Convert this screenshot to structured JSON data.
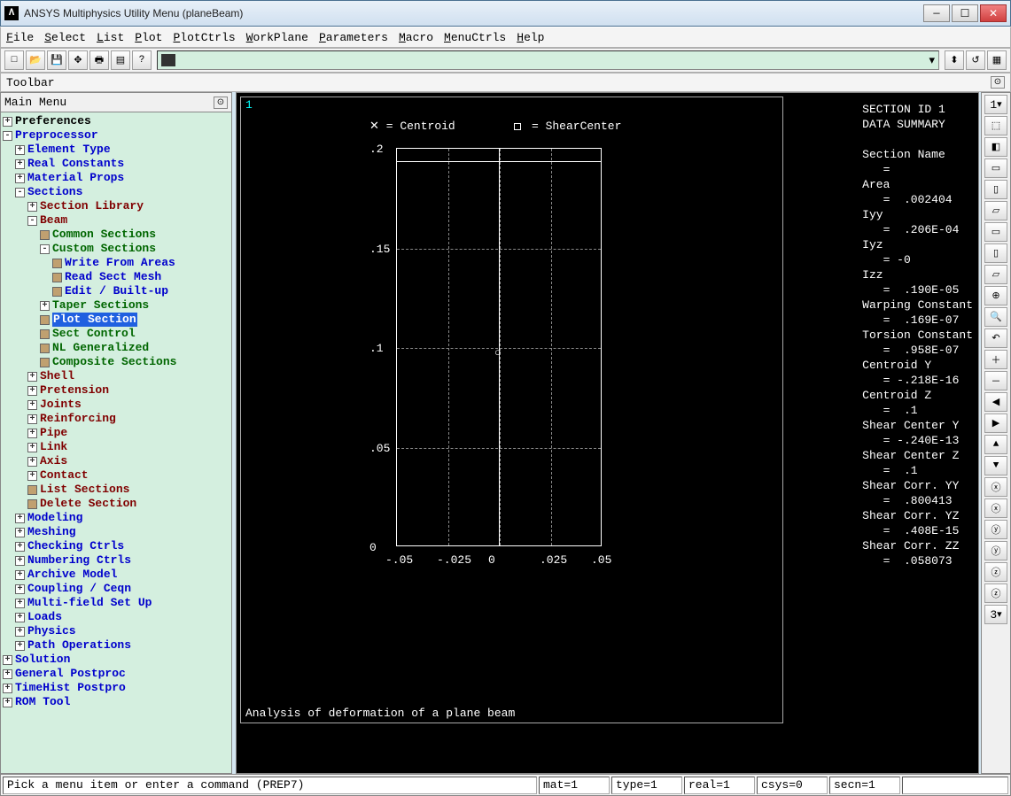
{
  "title": "ANSYS Multiphysics Utility Menu (planeBeam)",
  "menus": [
    "File",
    "Select",
    "List",
    "Plot",
    "PlotCtrls",
    "WorkPlane",
    "Parameters",
    "Macro",
    "MenuCtrls",
    "Help"
  ],
  "toolbar_label": "Toolbar",
  "mainmenu_label": "Main Menu",
  "tree": [
    {
      "ind": 0,
      "box": "⊞",
      "lbl": "Preferences",
      "cls": "black",
      "icon": "mini"
    },
    {
      "ind": 0,
      "box": "⊟",
      "lbl": "Preprocessor",
      "cls": "blue"
    },
    {
      "ind": 1,
      "box": "⊞",
      "lbl": "Element Type",
      "cls": "blue"
    },
    {
      "ind": 1,
      "box": "⊞",
      "lbl": "Real Constants",
      "cls": "blue"
    },
    {
      "ind": 1,
      "box": "⊞",
      "lbl": "Material Props",
      "cls": "blue"
    },
    {
      "ind": 1,
      "box": "⊟",
      "lbl": "Sections",
      "cls": "blue"
    },
    {
      "ind": 2,
      "box": "⊞",
      "lbl": "Section Library",
      "cls": "darkred"
    },
    {
      "ind": 2,
      "box": "⊟",
      "lbl": "Beam",
      "cls": "darkred"
    },
    {
      "ind": 3,
      "box": "",
      "lbl": "Common Sections",
      "cls": "green",
      "icon": "mini"
    },
    {
      "ind": 3,
      "box": "⊟",
      "lbl": "Custom Sections",
      "cls": "green"
    },
    {
      "ind": 4,
      "box": "",
      "lbl": "Write From Areas",
      "cls": "blue",
      "icon": "mini"
    },
    {
      "ind": 4,
      "box": "",
      "lbl": "Read Sect Mesh",
      "cls": "blue",
      "icon": "mini"
    },
    {
      "ind": 4,
      "box": "",
      "lbl": "Edit / Built-up",
      "cls": "blue",
      "icon": "mini"
    },
    {
      "ind": 3,
      "box": "⊞",
      "lbl": "Taper Sections",
      "cls": "green"
    },
    {
      "ind": 3,
      "box": "",
      "lbl": "Plot Section",
      "cls": "green",
      "icon": "mini",
      "sel": true
    },
    {
      "ind": 3,
      "box": "",
      "lbl": "Sect Control",
      "cls": "green",
      "icon": "mini"
    },
    {
      "ind": 3,
      "box": "",
      "lbl": "NL Generalized",
      "cls": "green",
      "icon": "mini"
    },
    {
      "ind": 3,
      "box": "",
      "lbl": "Composite Sections",
      "cls": "green",
      "icon": "mini"
    },
    {
      "ind": 2,
      "box": "⊞",
      "lbl": "Shell",
      "cls": "darkred"
    },
    {
      "ind": 2,
      "box": "⊞",
      "lbl": "Pretension",
      "cls": "darkred"
    },
    {
      "ind": 2,
      "box": "⊞",
      "lbl": "Joints",
      "cls": "darkred"
    },
    {
      "ind": 2,
      "box": "⊞",
      "lbl": "Reinforcing",
      "cls": "darkred"
    },
    {
      "ind": 2,
      "box": "⊞",
      "lbl": "Pipe",
      "cls": "darkred"
    },
    {
      "ind": 2,
      "box": "⊞",
      "lbl": "Link",
      "cls": "darkred"
    },
    {
      "ind": 2,
      "box": "⊞",
      "lbl": "Axis",
      "cls": "darkred"
    },
    {
      "ind": 2,
      "box": "⊞",
      "lbl": "Contact",
      "cls": "darkred"
    },
    {
      "ind": 2,
      "box": "",
      "lbl": "List Sections",
      "cls": "darkred",
      "icon": "mini"
    },
    {
      "ind": 2,
      "box": "",
      "lbl": "Delete Section",
      "cls": "darkred",
      "icon": "mini"
    },
    {
      "ind": 1,
      "box": "⊞",
      "lbl": "Modeling",
      "cls": "blue"
    },
    {
      "ind": 1,
      "box": "⊞",
      "lbl": "Meshing",
      "cls": "blue"
    },
    {
      "ind": 1,
      "box": "⊞",
      "lbl": "Checking Ctrls",
      "cls": "blue"
    },
    {
      "ind": 1,
      "box": "⊞",
      "lbl": "Numbering Ctrls",
      "cls": "blue"
    },
    {
      "ind": 1,
      "box": "⊞",
      "lbl": "Archive Model",
      "cls": "blue"
    },
    {
      "ind": 1,
      "box": "⊞",
      "lbl": "Coupling / Ceqn",
      "cls": "blue"
    },
    {
      "ind": 1,
      "box": "⊞",
      "lbl": "Multi-field Set Up",
      "cls": "blue"
    },
    {
      "ind": 1,
      "box": "⊞",
      "lbl": "Loads",
      "cls": "blue"
    },
    {
      "ind": 1,
      "box": "⊞",
      "lbl": "Physics",
      "cls": "blue"
    },
    {
      "ind": 1,
      "box": "⊞",
      "lbl": "Path Operations",
      "cls": "blue"
    },
    {
      "ind": 0,
      "box": "⊞",
      "lbl": "Solution",
      "cls": "blue"
    },
    {
      "ind": 0,
      "box": "⊞",
      "lbl": "General Postproc",
      "cls": "blue"
    },
    {
      "ind": 0,
      "box": "⊞",
      "lbl": "TimeHist Postpro",
      "cls": "blue"
    },
    {
      "ind": 0,
      "box": "⊞",
      "lbl": "ROM Tool",
      "cls": "blue"
    }
  ],
  "plot": {
    "frame": "1",
    "legend_centroid": "= Centroid",
    "legend_shear": "= ShearCenter",
    "ylabels": [
      ".2",
      ".15",
      ".1",
      ".05",
      "0"
    ],
    "xlabels": [
      "-.05",
      "-.025",
      "0",
      ".025",
      ".05"
    ],
    "title": "Analysis of deformation of a plane beam"
  },
  "summary": {
    "h1": "SECTION ID 1",
    "h2": "DATA SUMMARY",
    "rows": [
      [
        "Section Name",
        "="
      ],
      [
        "Area",
        "=  .002404"
      ],
      [
        "Iyy",
        "=  .206E-04"
      ],
      [
        "Iyz",
        "= -0"
      ],
      [
        "Izz",
        "=  .190E-05"
      ],
      [
        "Warping Constant",
        "=  .169E-07"
      ],
      [
        "Torsion Constant",
        "=  .958E-07"
      ],
      [
        "Centroid Y",
        "= -.218E-16"
      ],
      [
        "Centroid Z",
        "=  .1"
      ],
      [
        "Shear Center Y",
        "= -.240E-13"
      ],
      [
        "Shear Center Z",
        "=  .1"
      ],
      [
        "Shear Corr. YY",
        "=  .800413"
      ],
      [
        "Shear Corr. YZ",
        "=  .408E-15"
      ],
      [
        "Shear Corr. ZZ",
        "=  .058073"
      ]
    ]
  },
  "right_top": "1",
  "right_bottom": "3",
  "status": {
    "main": "Pick a menu item or enter a command (PREP7)",
    "cells": [
      "mat=1",
      "type=1",
      "real=1",
      "csys=0",
      "secn=1",
      ""
    ]
  },
  "chart_data": {
    "type": "other",
    "title": "Analysis of deformation of a plane beam",
    "x": [
      -0.05,
      -0.025,
      0,
      0.025,
      0.05
    ],
    "y": [
      0,
      0.05,
      0.1,
      0.15,
      0.2
    ],
    "xlim": [
      -0.05,
      0.05
    ],
    "ylim": [
      0,
      0.2
    ],
    "section_outline": {
      "ymin": 0,
      "ymax": 0.2,
      "xmin": -0.05,
      "xmax": 0.05
    },
    "centroid": {
      "y": 0,
      "z": 0.1
    },
    "shear_center": {
      "y": 0,
      "z": 0.1
    }
  }
}
